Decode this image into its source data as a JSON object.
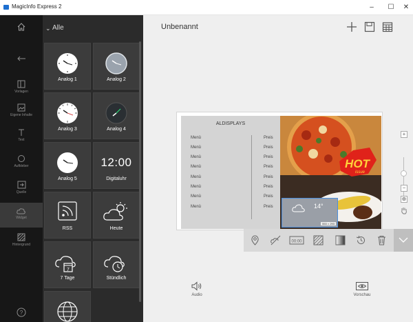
{
  "window": {
    "title": "MagicInfo Express 2",
    "controls": {
      "minimize": "–",
      "maximize": "☐",
      "close": "✕"
    }
  },
  "rail": {
    "items": [
      {
        "name": "home",
        "label": ""
      },
      {
        "name": "back",
        "label": ""
      },
      {
        "name": "templates",
        "label": "Vorlagen"
      },
      {
        "name": "own-content",
        "label": "Eigene Inhalte"
      },
      {
        "name": "text",
        "label": "Text"
      },
      {
        "name": "stickers",
        "label": "Aufkleber"
      },
      {
        "name": "source",
        "label": "Quelle"
      },
      {
        "name": "widget",
        "label": "Widget"
      },
      {
        "name": "background",
        "label": "Hintergrund"
      },
      {
        "name": "help",
        "label": "?"
      }
    ],
    "active": "widget"
  },
  "panel": {
    "filter_label": "Alle",
    "tiles": [
      {
        "label": "Analog 1",
        "icon": "analog-clock-icon"
      },
      {
        "label": "Analog 2",
        "icon": "analog-clock-icon"
      },
      {
        "label": "Analog 3",
        "icon": "analog-clock-icon"
      },
      {
        "label": "Analog 4",
        "icon": "analog-clock-icon"
      },
      {
        "label": "Analog 5",
        "icon": "analog-clock-icon"
      },
      {
        "label": "Digitaluhr",
        "icon": "digital-clock",
        "display": "12:00"
      },
      {
        "label": "RSS",
        "icon": "rss-icon"
      },
      {
        "label": "Heute",
        "icon": "weather-today-icon"
      },
      {
        "label": "7 Tage",
        "icon": "weather-week-icon"
      },
      {
        "label": "Stündlich",
        "icon": "weather-hourly-icon"
      },
      {
        "label": "",
        "icon": "globe-icon"
      }
    ]
  },
  "main": {
    "document_title": "Unbenannt",
    "toolbar": [
      "add-icon",
      "save-icon",
      "grid-icon"
    ]
  },
  "canvas": {
    "menu_title": "ALDISPLAYS",
    "rows": [
      {
        "item": "Menü",
        "price": "Preis"
      },
      {
        "item": "Menü",
        "price": "Preis"
      },
      {
        "item": "Menü",
        "price": "Preis"
      },
      {
        "item": "Menü",
        "price": "Preis"
      },
      {
        "item": "Menü",
        "price": "Preis"
      },
      {
        "item": "Menü",
        "price": "Preis"
      },
      {
        "item": "Menü",
        "price": "Preis"
      },
      {
        "item": "Menü",
        "price": "Preis"
      }
    ],
    "hot_text": "HOT",
    "hot_sub": "issue",
    "weather": {
      "temp": "14°",
      "size_badge": "553 × 293"
    }
  },
  "widget_toolbar": [
    "location-icon",
    "no-weather-icon",
    "clock-format-icon",
    "pattern-icon",
    "gradient-icon",
    "history-icon",
    "trash-icon"
  ],
  "bottom": {
    "audio_label": "Audio",
    "preview_label": "Vorschau"
  },
  "zoom": {
    "plus": "+",
    "minus": "−",
    "fit": "⊕"
  },
  "colors": {
    "rail": "#171717",
    "panel": "#2b2b2b",
    "tile": "#3c3c3c",
    "main": "#efefef",
    "accent": "#4a8fe0"
  }
}
